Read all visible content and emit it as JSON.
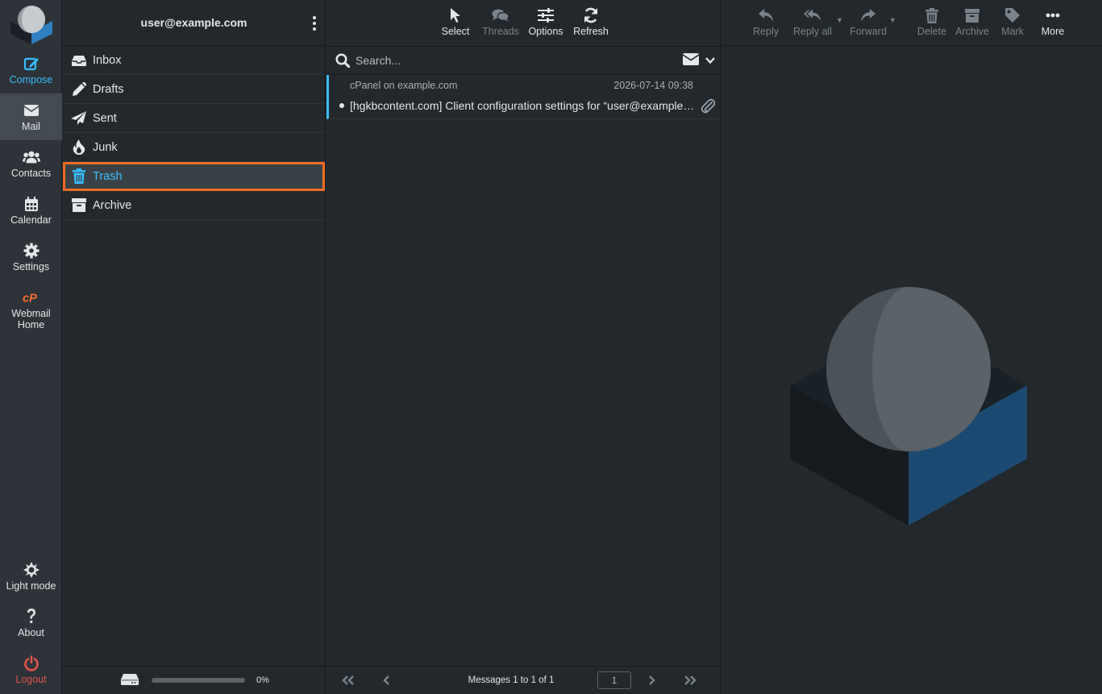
{
  "nav": {
    "compose": "Compose",
    "mail": "Mail",
    "contacts": "Contacts",
    "calendar": "Calendar",
    "settings": "Settings",
    "webmail_home": "Webmail Home",
    "light_mode": "Light mode",
    "about": "About",
    "logout": "Logout"
  },
  "account": {
    "email": "user@example.com"
  },
  "folders": [
    {
      "label": "Inbox",
      "icon": "inbox-icon"
    },
    {
      "label": "Drafts",
      "icon": "pencil-icon"
    },
    {
      "label": "Sent",
      "icon": "paper-plane-icon"
    },
    {
      "label": "Junk",
      "icon": "fire-icon"
    },
    {
      "label": "Trash",
      "icon": "trash-icon",
      "selected": true
    },
    {
      "label": "Archive",
      "icon": "archive-icon"
    }
  ],
  "quota": {
    "percent_label": "0%",
    "fraction": 0
  },
  "list_toolbar": {
    "select": "Select",
    "threads": "Threads",
    "options": "Options",
    "refresh": "Refresh"
  },
  "search": {
    "placeholder": "Search..."
  },
  "messages": [
    {
      "from": "cPanel on example.com",
      "date": "2026-07-14 09:38",
      "subject": "[hgkbcontent.com] Client configuration settings for “user@example.com”",
      "has_attachment": true
    }
  ],
  "pager": {
    "status": "Messages 1 to 1 of 1",
    "page": "1"
  },
  "message_toolbar": {
    "reply": "Reply",
    "reply_all": "Reply all",
    "forward": "Forward",
    "delete": "Delete",
    "archive": "Archive",
    "mark": "Mark",
    "more": "More"
  },
  "colors": {
    "accent": "#37beff",
    "highlight": "#f36b20",
    "logout": "#e5534b",
    "cpanel_orange": "#ff6c2c"
  }
}
